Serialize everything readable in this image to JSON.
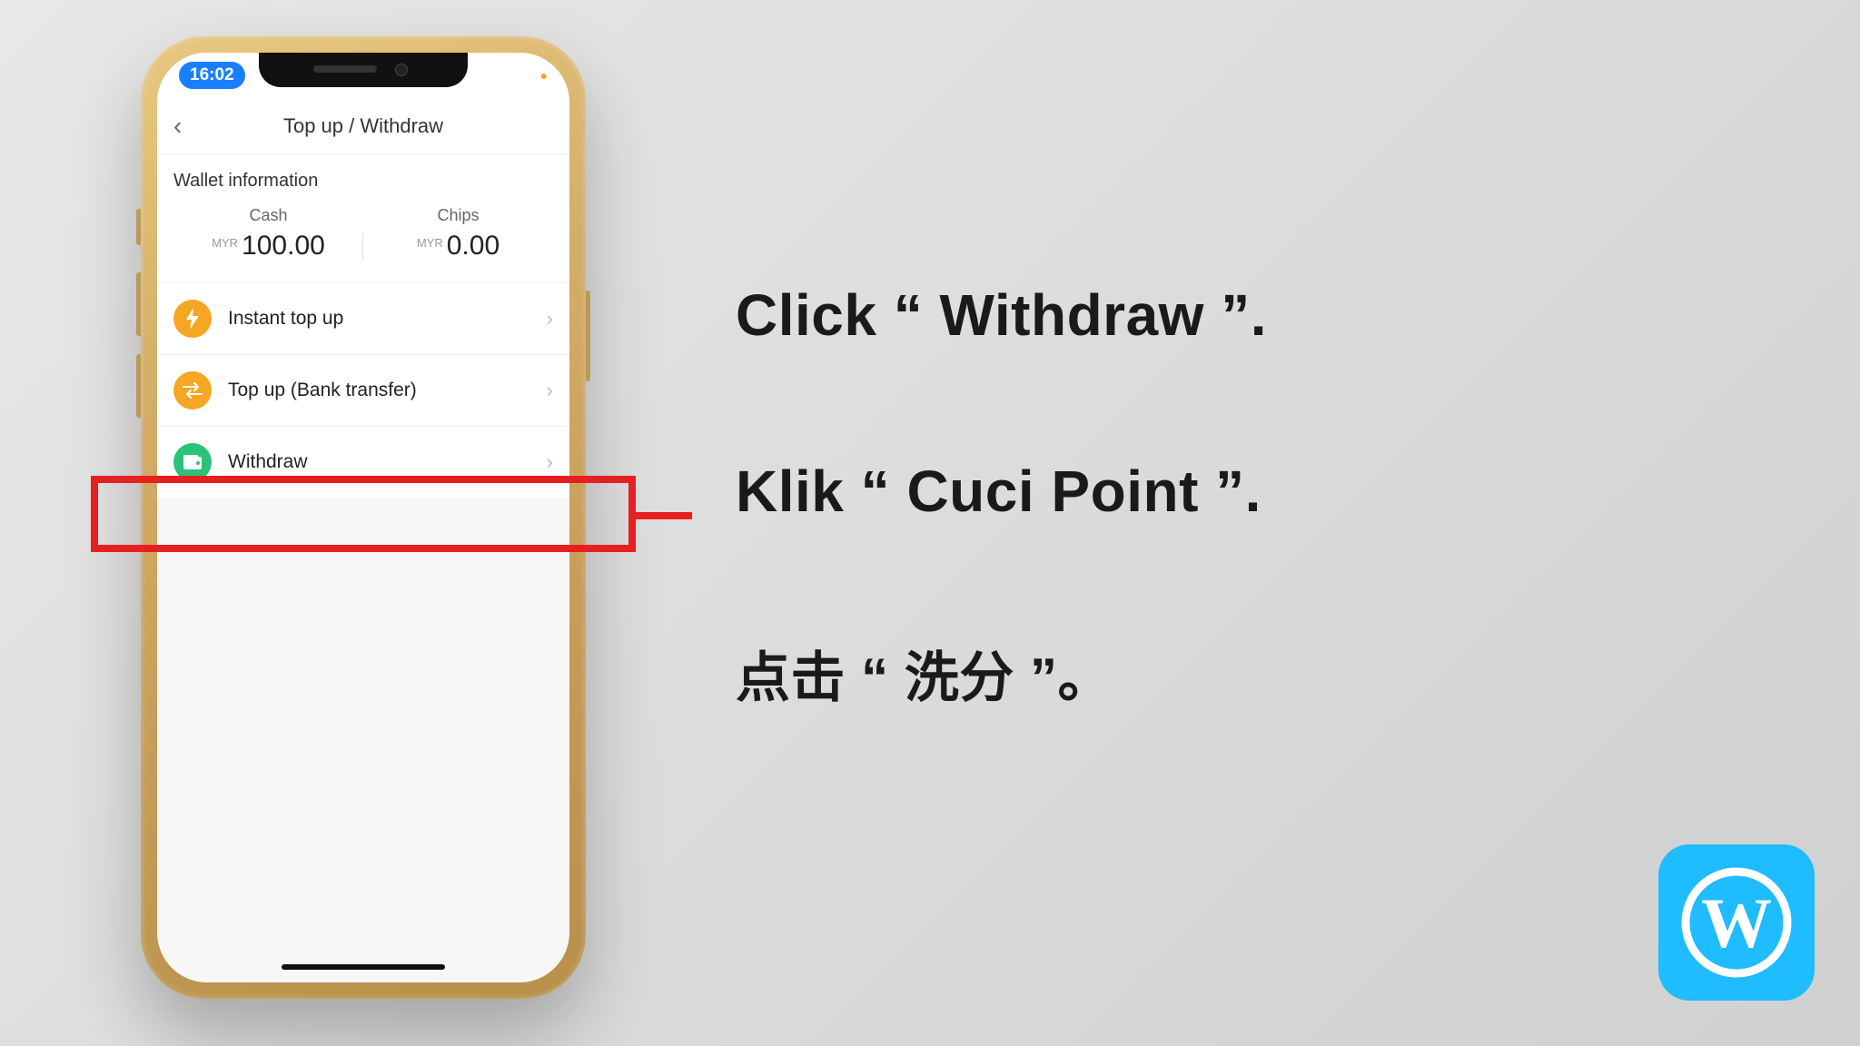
{
  "status": {
    "time": "16:02"
  },
  "header": {
    "title": "Top up / Withdraw"
  },
  "wallet": {
    "heading": "Wallet information",
    "cash": {
      "label": "Cash",
      "currency": "MYR",
      "amount": "100.00"
    },
    "chips": {
      "label": "Chips",
      "currency": "MYR",
      "amount": "0.00"
    }
  },
  "menu": {
    "instant_topup": "Instant top up",
    "bank_transfer": "Top up (Bank transfer)",
    "withdraw": "Withdraw"
  },
  "instructions": {
    "en": "Click “ Withdraw ”.",
    "ms": "Klik “ Cuci Point ”.",
    "cn": "点击 “ 洗分 ”。"
  },
  "glyphs": {
    "back": "‹",
    "chevron": "›"
  }
}
